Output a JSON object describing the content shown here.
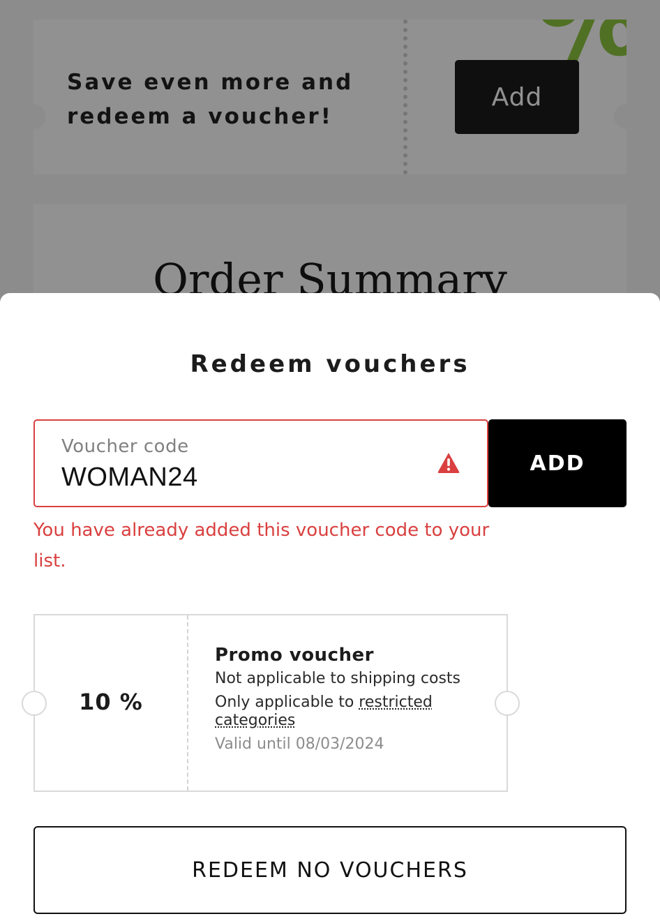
{
  "background": {
    "promo_card": {
      "text": "Save even more and redeem a voucher!",
      "add_label": "Add",
      "decoration_glyph": "%"
    },
    "order_summary": {
      "title": "Order Summary"
    }
  },
  "sheet": {
    "title": "Redeem vouchers",
    "code_field": {
      "label": "Voucher code",
      "value": "WOMAN24",
      "status_icon": "warning-triangle-icon"
    },
    "add_label": "ADD",
    "error": "You have already added this voucher code to your list.",
    "voucher": {
      "value": "10 %",
      "name": "Promo voucher",
      "line_shipping": "Not applicable to shipping costs",
      "line_restricted_prefix": "Only applicable to ",
      "line_restricted_link": "restricted categories",
      "validity": "Valid until 08/03/2024"
    },
    "redeem_none_label": "REDEEM NO VOUCHERS"
  },
  "colors": {
    "error_red": "#d9403f",
    "accent_green": "#8dc63f",
    "button_black": "#000000",
    "overlay": "rgba(0,0,0,0.43)"
  }
}
